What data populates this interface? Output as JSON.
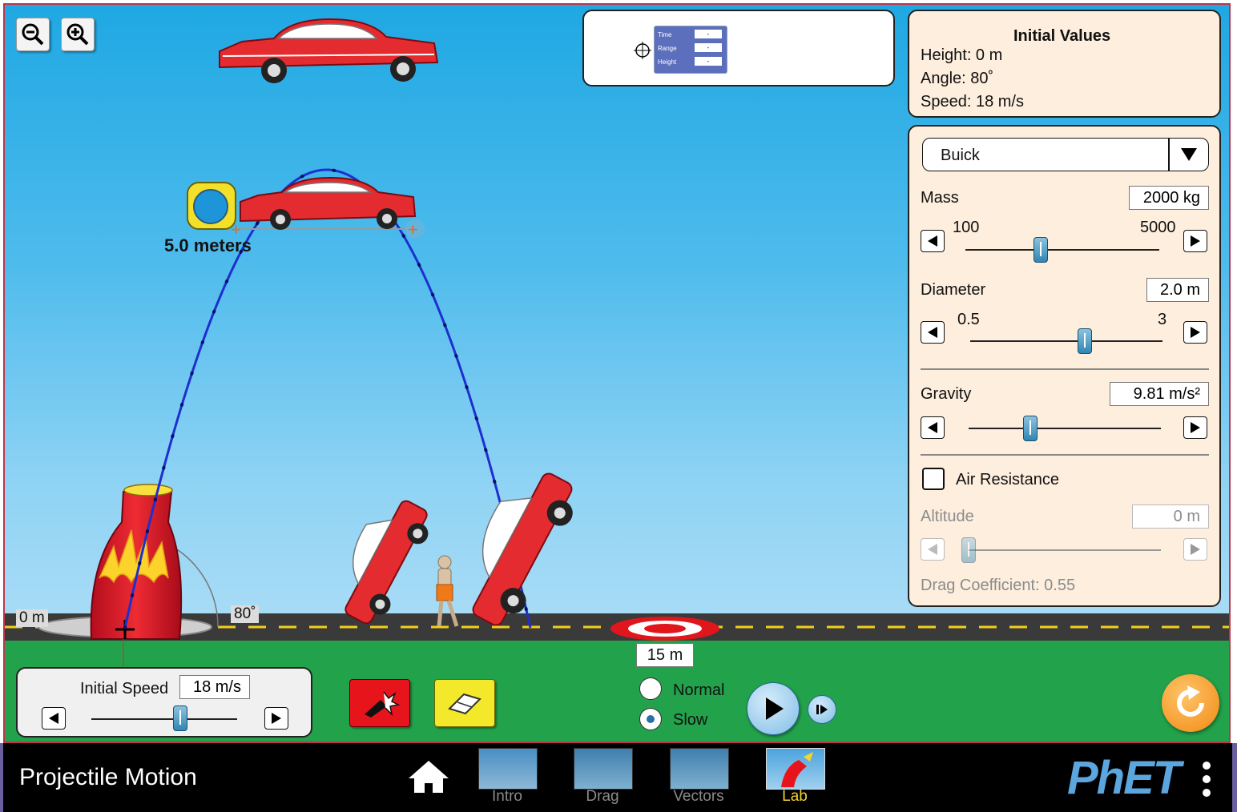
{
  "zoom": {
    "out_icon": "zoom-out-icon",
    "in_icon": "zoom-in-icon"
  },
  "data_probe": {
    "time_label": "Time",
    "range_label": "Range",
    "height_label": "Height",
    "time_value": "-",
    "range_value": "-",
    "height_value": "-"
  },
  "initial_values": {
    "title": "Initial Values",
    "height": "Height: 0 m",
    "angle": "Angle: 80˚",
    "speed": "Speed: 18 m/s"
  },
  "controls": {
    "projectile": "Buick",
    "mass": {
      "label": "Mass",
      "value": "2000 kg",
      "min": "100",
      "max": "5000",
      "fraction": 0.39
    },
    "diameter": {
      "label": "Diameter",
      "value": "2.0 m",
      "min": "0.5",
      "max": "3",
      "fraction": 0.6
    },
    "gravity": {
      "label": "Gravity",
      "value": "9.81 m/s²",
      "fraction": 0.32
    },
    "air_resistance": {
      "label": "Air Resistance",
      "checked": false
    },
    "altitude": {
      "label": "Altitude",
      "value": "0 m",
      "fraction": 0.0
    },
    "drag": "Drag Coefficient: 0.55"
  },
  "scene": {
    "tape_measure": "5.0 meters",
    "height_marker": "0 m",
    "angle_marker": "80˚",
    "target_distance": "15 m"
  },
  "launch_panel": {
    "speed_label": "Initial Speed",
    "speed_value": "18 m/s",
    "fraction": 0.66
  },
  "playback": {
    "normal": "Normal",
    "slow": "Slow",
    "selected": "slow"
  },
  "nav": {
    "title": "Projectile Motion",
    "screens": [
      {
        "label": "Intro",
        "active": false
      },
      {
        "label": "Drag",
        "active": false
      },
      {
        "label": "Vectors",
        "active": false
      },
      {
        "label": "Lab",
        "active": true
      }
    ],
    "brand": "PhET"
  },
  "colors": {
    "sky": "#1fa8e3",
    "ground": "#22a24a",
    "trajectory": "#1e2fd0",
    "panel": "#fdeedd",
    "nav_active": "#f3d02f",
    "reset": "#f39c1f"
  }
}
